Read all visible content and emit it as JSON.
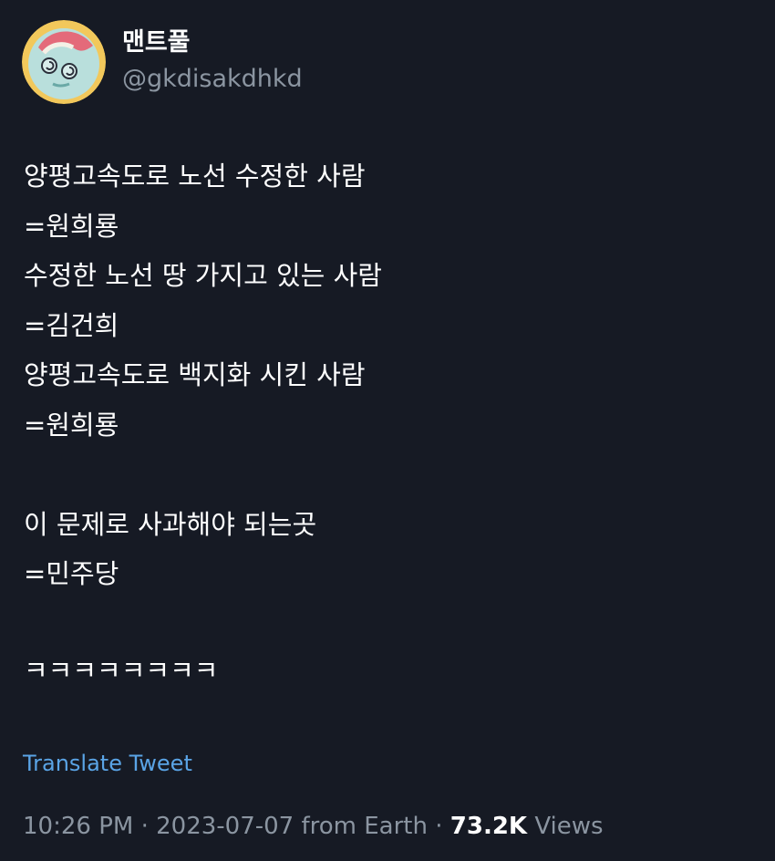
{
  "author": {
    "display_name": "맨트풀",
    "handle": "@gkdisakdhkd",
    "avatar_icon": "cartoon-character-avatar"
  },
  "tweet": {
    "lines": [
      "양평고속도로 노선 수정한 사람",
      "=원희룡",
      "수정한 노선 땅 가지고 있는 사람",
      "=김건희",
      "양평고속도로 백지화 시킨 사람",
      "=원희룡",
      "",
      "이 문제로 사과해야 되는곳",
      "=민주당"
    ],
    "laugh": "ㅋㅋㅋㅋㅋㅋㅋㅋ"
  },
  "translate_label": "Translate Tweet",
  "meta": {
    "time": "10:26 PM",
    "date": "2023-07-07",
    "source": "from Earth",
    "views_count": "73.2K",
    "views_label": "Views",
    "separator": "·"
  },
  "colors": {
    "background": "#161a24",
    "text": "#ffffff",
    "secondary": "#8b95a1",
    "link": "#5aa4e6"
  }
}
